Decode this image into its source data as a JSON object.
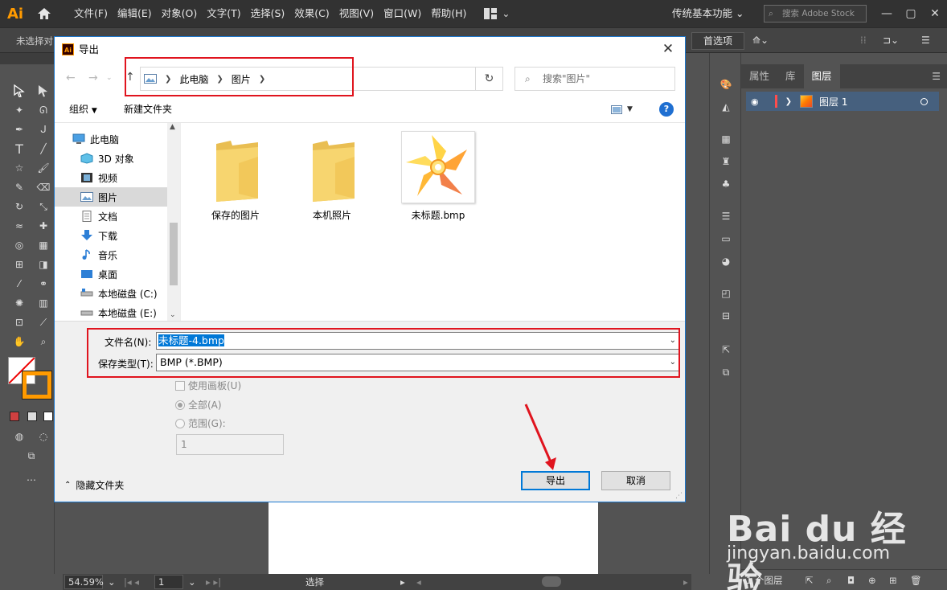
{
  "app": {
    "logo": "Ai",
    "menus": [
      "文件(F)",
      "编辑(E)",
      "对象(O)",
      "文字(T)",
      "选择(S)",
      "效果(C)",
      "视图(V)",
      "窗口(W)",
      "帮助(H)"
    ],
    "workspace": "传统基本功能",
    "stock_search_placeholder": "搜索 Adobe Stock",
    "control_bar_label": "未选择对",
    "preferences_button": "首选项",
    "accent_color": "#ff9a00"
  },
  "layers_panel": {
    "tabs": [
      "属性",
      "库",
      "图层"
    ],
    "active_tab": "图层",
    "layer_name": "图层 1",
    "footer_count": "1 个图层"
  },
  "status_bar": {
    "zoom": "54.59%",
    "page": "1",
    "tool": "选择"
  },
  "dialog": {
    "title": "导出",
    "breadcrumb": [
      "此电脑",
      "图片"
    ],
    "search_placeholder": "搜索\"图片\"",
    "organize_label": "组织",
    "new_folder_label": "新建文件夹",
    "help_label": "?",
    "nav_items": [
      "此电脑",
      "3D 对象",
      "视频",
      "图片",
      "文档",
      "下载",
      "音乐",
      "桌面",
      "本地磁盘 (C:)",
      "本地磁盘 (E:)"
    ],
    "selected_nav": "图片",
    "files": [
      "保存的图片",
      "本机照片",
      "未标题.bmp"
    ],
    "filename_label": "文件名(N):",
    "filename_value": "未标题-4.bmp",
    "filetype_label": "保存类型(T):",
    "filetype_value": "BMP (*.BMP)",
    "use_artboards": "使用画板(U)",
    "all_label": "全部(A)",
    "range_label": "范围(G):",
    "range_value": "1",
    "hide_folders": "隐藏文件夹",
    "export_button": "导出",
    "cancel_button": "取消",
    "annotation_color": "#e0141e"
  },
  "watermark": {
    "brand": "Bai du 经验",
    "url": "jingyan.baidu.com"
  }
}
